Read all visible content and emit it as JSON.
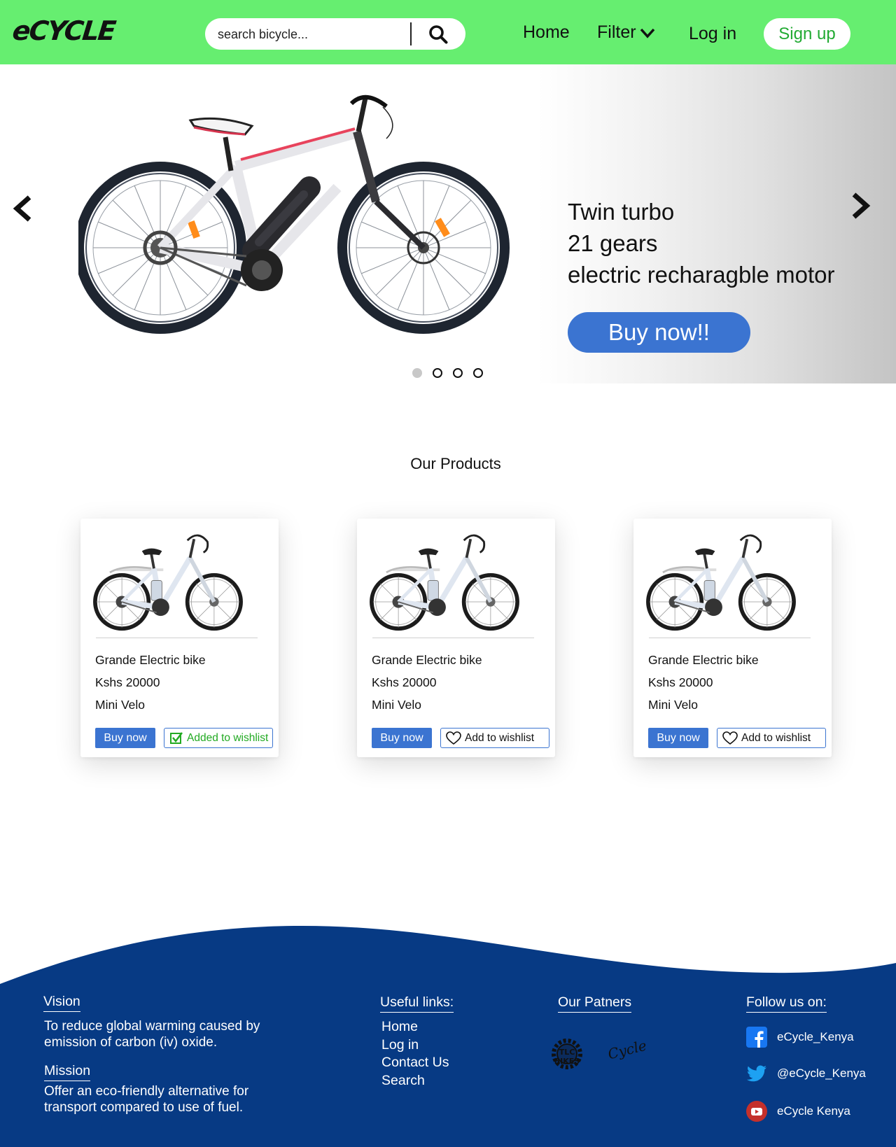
{
  "header": {
    "logo": "eCYCLE",
    "search_placeholder": "search bicycle...",
    "nav": {
      "home": "Home",
      "filter": "Filter",
      "login": "Log in",
      "signup": "Sign up"
    }
  },
  "hero": {
    "lines": [
      "Twin turbo",
      "21 gears",
      "electric recharagble motor"
    ],
    "cta": "Buy now!!",
    "slides": 4,
    "active_slide": 1
  },
  "products": {
    "title": "Our Products",
    "items": [
      {
        "name": "Grande Electric bike",
        "price": "Kshs 20000",
        "type": "Mini Velo",
        "buy": "Buy now",
        "wishlist": "Added to wishlist",
        "wishlisted": true
      },
      {
        "name": "Grande Electric bike",
        "price": "Kshs 20000",
        "type": "Mini Velo",
        "buy": "Buy now",
        "wishlist": "Add to wishlist",
        "wishlisted": false
      },
      {
        "name": "Grande Electric bike",
        "price": "Kshs 20000",
        "type": "Mini Velo",
        "buy": "Buy now",
        "wishlist": "Add to wishlist",
        "wishlisted": false
      }
    ]
  },
  "footer": {
    "vision_title": "Vision",
    "vision_text_1": "To reduce global warming caused by",
    "vision_text_2": "emission of carbon (iv) oxide.",
    "mission_title": "Mission",
    "mission_text_1": "Offer an eco-friendly alternative for",
    "mission_text_2": "transport compared to use of fuel.",
    "useful_links_title": "Useful links:",
    "useful_links": [
      "Home",
      "Log in",
      "Contact Us",
      "Search"
    ],
    "partners_title": "Our Patners",
    "partners": [
      "TLC BIKES",
      "Cycle"
    ],
    "follow_title": "Follow us on:",
    "social": [
      {
        "network": "facebook-icon",
        "handle": "eCycle_Kenya"
      },
      {
        "network": "twitter-icon",
        "handle": "@eCycle_Kenya"
      },
      {
        "network": "youtube-icon",
        "handle": "eCycle Kenya"
      }
    ]
  },
  "colors": {
    "header": "#66ee70",
    "accent": "#3b74d1",
    "footer": "#073a84",
    "wishlist_added": "#22aa22",
    "signup_text": "#22aa33"
  }
}
